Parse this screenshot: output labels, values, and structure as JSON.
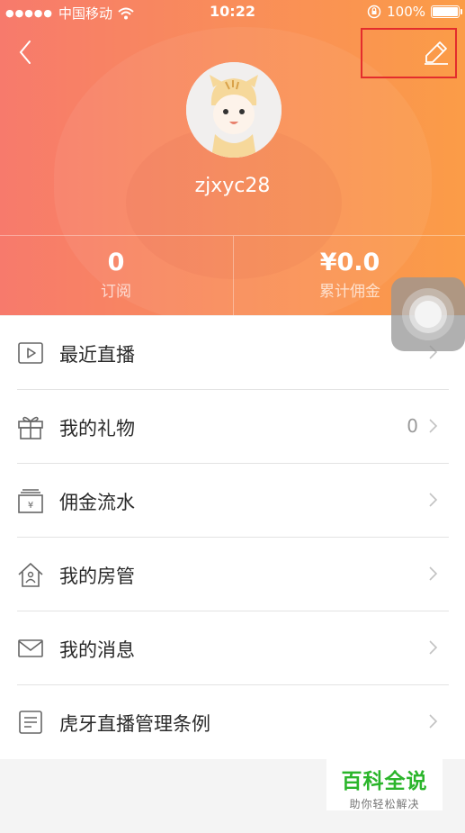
{
  "status_bar": {
    "signal_dots": "●●●●●",
    "carrier": "中国移动",
    "time": "10:22",
    "battery_percent": "100%"
  },
  "header": {
    "background_colors": [
      "#f77a6c",
      "#fb9c47"
    ],
    "back_icon": "chevron-left-icon",
    "edit_icon": "pencil-icon",
    "username": "zjxyc28"
  },
  "stats": [
    {
      "value": "0",
      "label": "订阅"
    },
    {
      "value": "¥0.0",
      "label": "累计佣金"
    }
  ],
  "menu": [
    {
      "label": "最近直播",
      "icon": "play-icon",
      "count": ""
    },
    {
      "label": "我的礼物",
      "icon": "gift-icon",
      "count": "0"
    },
    {
      "label": "佣金流水",
      "icon": "yen-box-icon",
      "count": ""
    },
    {
      "label": "我的房管",
      "icon": "house-person-icon",
      "count": ""
    },
    {
      "label": "我的消息",
      "icon": "mail-icon",
      "count": ""
    },
    {
      "label": "虎牙直播管理条例",
      "icon": "document-icon",
      "count": ""
    }
  ],
  "watermark": {
    "title": "百科全说",
    "subtitle": "助你轻松解决"
  }
}
